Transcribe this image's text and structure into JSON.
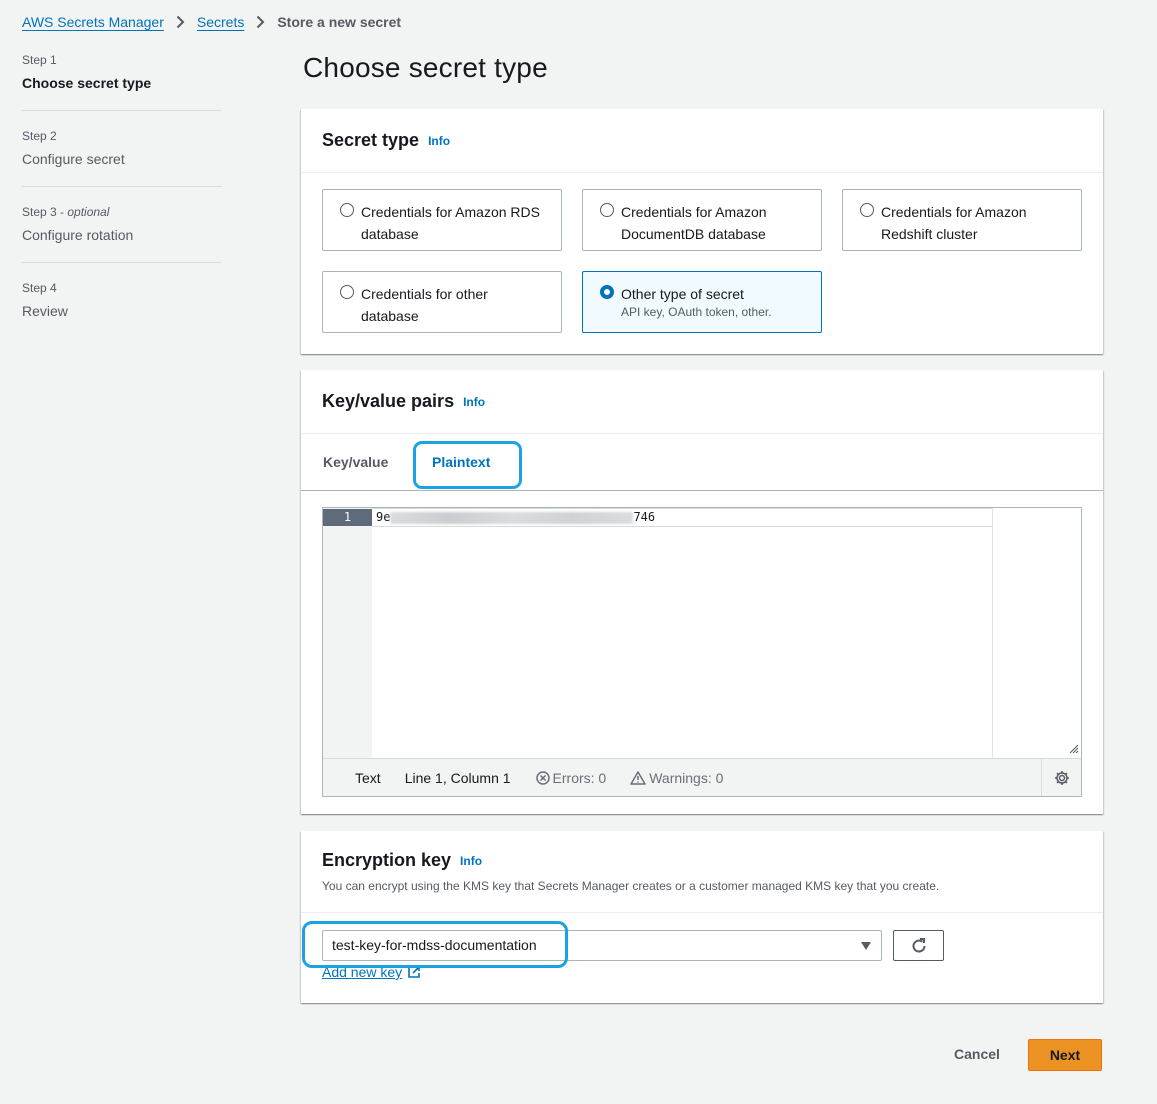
{
  "breadcrumb": {
    "items": [
      "AWS Secrets Manager",
      "Secrets"
    ],
    "current": "Store a new secret"
  },
  "steps": [
    {
      "number": "Step 1",
      "optional": "",
      "title": "Choose secret type"
    },
    {
      "number": "Step 2",
      "optional": "",
      "title": "Configure secret"
    },
    {
      "number": "Step 3 - ",
      "optional": "optional",
      "title": "Configure rotation"
    },
    {
      "number": "Step 4",
      "optional": "",
      "title": "Review"
    }
  ],
  "page_title": "Choose secret type",
  "secret_type": {
    "heading": "Secret type",
    "info": "Info",
    "options": [
      {
        "label": "Credentials for Amazon RDS database",
        "sub": ""
      },
      {
        "label": "Credentials for Amazon DocumentDB database",
        "sub": ""
      },
      {
        "label": "Credentials for Amazon Redshift cluster",
        "sub": ""
      },
      {
        "label": "Credentials for other database",
        "sub": ""
      },
      {
        "label": "Other type of secret",
        "sub": "API key, OAuth token, other."
      }
    ],
    "selected": "Other type of secret"
  },
  "kv_pairs": {
    "heading": "Key/value pairs",
    "info": "Info",
    "tabs": [
      "Key/value",
      "Plaintext"
    ],
    "active_tab": "Plaintext",
    "editor": {
      "line_number": "1",
      "value_start": "9e",
      "value_end": "746",
      "mode": "Text",
      "position": "Line 1, Column 1",
      "errors": "Errors: 0",
      "warnings": "Warnings: 0"
    }
  },
  "encryption": {
    "heading": "Encryption key",
    "info": "Info",
    "description": "You can encrypt using the KMS key that Secrets Manager creates or a customer managed KMS key that you create.",
    "selected_key": "test-key-for-mdss-documentation",
    "add_key": "Add new key"
  },
  "footer": {
    "cancel": "Cancel",
    "next": "Next"
  },
  "colors": {
    "link": "#0073bb",
    "primary_button": "#ec9223",
    "highlight_annotation": "#1aa3e0",
    "selected_tile_bg": "#f1faff"
  }
}
